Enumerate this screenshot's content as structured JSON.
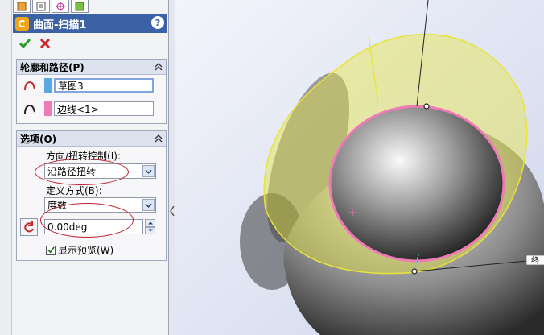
{
  "feature": {
    "title": "曲面-扫描1",
    "help_icon": "help-icon"
  },
  "actions": {
    "ok_icon": "green-check-icon",
    "cancel_icon": "red-x-icon"
  },
  "profile_path": {
    "header": "轮廓和路径(P)",
    "profile": {
      "value": "草图3",
      "swatch_color": "#5aa7e6"
    },
    "path": {
      "value": "边线<1>",
      "swatch_color": "#f079b7"
    }
  },
  "options": {
    "header": "选项(O)",
    "orientation_label": "方向/扭转控制(I):",
    "orientation_value": "沿路径扭转",
    "define_label": "定义方式(B):",
    "define_value": "度数",
    "angle_value": "0.00deg",
    "show_preview_label": "显示预览(W)",
    "show_preview_checked": true
  },
  "viewport": {
    "tag_text": "终"
  },
  "colors": {
    "accent_blue": "#3b62a6",
    "highlight_pink": "#f079b7",
    "preview_yellow": "#e8e437"
  }
}
